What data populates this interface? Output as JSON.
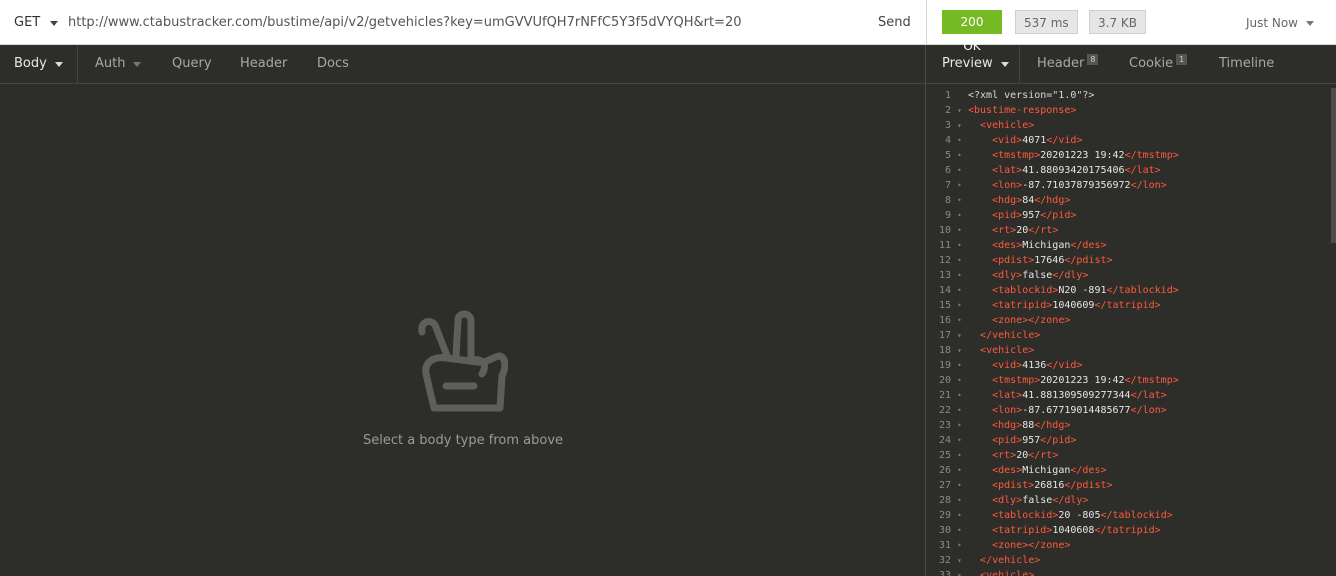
{
  "request": {
    "method": "GET",
    "url": "http://www.ctabustracker.com/bustime/api/v2/getvehicles?key=umGVVUfQH7rNFfC5Y3f5dVYQH&rt=20",
    "send_label": "Send",
    "tabs": [
      {
        "label": "Body",
        "active": true
      },
      {
        "label": "Auth"
      },
      {
        "label": "Query"
      },
      {
        "label": "Header"
      },
      {
        "label": "Docs"
      }
    ],
    "empty_message": "Select a body type from above"
  },
  "response": {
    "status": "200 OK",
    "time": "537 ms",
    "size": "3.7 KB",
    "history": "Just Now",
    "tabs": [
      {
        "label": "Preview",
        "active": true
      },
      {
        "label": "Header",
        "count": "8"
      },
      {
        "label": "Cookie",
        "count": "1"
      },
      {
        "label": "Timeline"
      }
    ],
    "lines": [
      {
        "n": "1",
        "indent": "",
        "raw": "<?xml version=\"1.0\"?>"
      },
      {
        "n": "2",
        "indent": "",
        "open": "bustime-response"
      },
      {
        "n": "3",
        "indent": "  ",
        "open": "vehicle"
      },
      {
        "n": "4",
        "indent": "    ",
        "tag": "vid",
        "val": "4071"
      },
      {
        "n": "5",
        "indent": "    ",
        "tag": "tmstmp",
        "val": "20201223 19:42"
      },
      {
        "n": "6",
        "indent": "    ",
        "tag": "lat",
        "val": "41.88093420175406"
      },
      {
        "n": "7",
        "indent": "    ",
        "tag": "lon",
        "val": "-87.71037879356972"
      },
      {
        "n": "8",
        "indent": "    ",
        "tag": "hdg",
        "val": "84"
      },
      {
        "n": "9",
        "indent": "    ",
        "tag": "pid",
        "val": "957"
      },
      {
        "n": "10",
        "indent": "    ",
        "tag": "rt",
        "val": "20"
      },
      {
        "n": "11",
        "indent": "    ",
        "tag": "des",
        "val": "Michigan"
      },
      {
        "n": "12",
        "indent": "    ",
        "tag": "pdist",
        "val": "17646"
      },
      {
        "n": "13",
        "indent": "    ",
        "tag": "dly",
        "val": "false"
      },
      {
        "n": "14",
        "indent": "    ",
        "tag": "tablockid",
        "val": "N20 -891"
      },
      {
        "n": "15",
        "indent": "    ",
        "tag": "tatripid",
        "val": "1040609"
      },
      {
        "n": "16",
        "indent": "    ",
        "tag": "zone",
        "val": ""
      },
      {
        "n": "17",
        "indent": "  ",
        "close": "vehicle"
      },
      {
        "n": "18",
        "indent": "  ",
        "open": "vehicle"
      },
      {
        "n": "19",
        "indent": "    ",
        "tag": "vid",
        "val": "4136"
      },
      {
        "n": "20",
        "indent": "    ",
        "tag": "tmstmp",
        "val": "20201223 19:42"
      },
      {
        "n": "21",
        "indent": "    ",
        "tag": "lat",
        "val": "41.881309509277344"
      },
      {
        "n": "22",
        "indent": "    ",
        "tag": "lon",
        "val": "-87.67719014485677"
      },
      {
        "n": "23",
        "indent": "    ",
        "tag": "hdg",
        "val": "88"
      },
      {
        "n": "24",
        "indent": "    ",
        "tag": "pid",
        "val": "957"
      },
      {
        "n": "25",
        "indent": "    ",
        "tag": "rt",
        "val": "20"
      },
      {
        "n": "26",
        "indent": "    ",
        "tag": "des",
        "val": "Michigan"
      },
      {
        "n": "27",
        "indent": "    ",
        "tag": "pdist",
        "val": "26816"
      },
      {
        "n": "28",
        "indent": "    ",
        "tag": "dly",
        "val": "false"
      },
      {
        "n": "29",
        "indent": "    ",
        "tag": "tablockid",
        "val": "20 -805"
      },
      {
        "n": "30",
        "indent": "    ",
        "tag": "tatripid",
        "val": "1040608"
      },
      {
        "n": "31",
        "indent": "    ",
        "tag": "zone",
        "val": ""
      },
      {
        "n": "32",
        "indent": "  ",
        "close": "vehicle"
      },
      {
        "n": "33",
        "indent": "  ",
        "open": "vehicle"
      }
    ]
  },
  "colors": {
    "status_ok": "#75ba24",
    "xml_tag": "#ff5a3c",
    "background": "#2d2d2a"
  },
  "icons": {
    "method_dropdown": "chevron-down-icon",
    "empty_state": "peace-hand-icon"
  }
}
